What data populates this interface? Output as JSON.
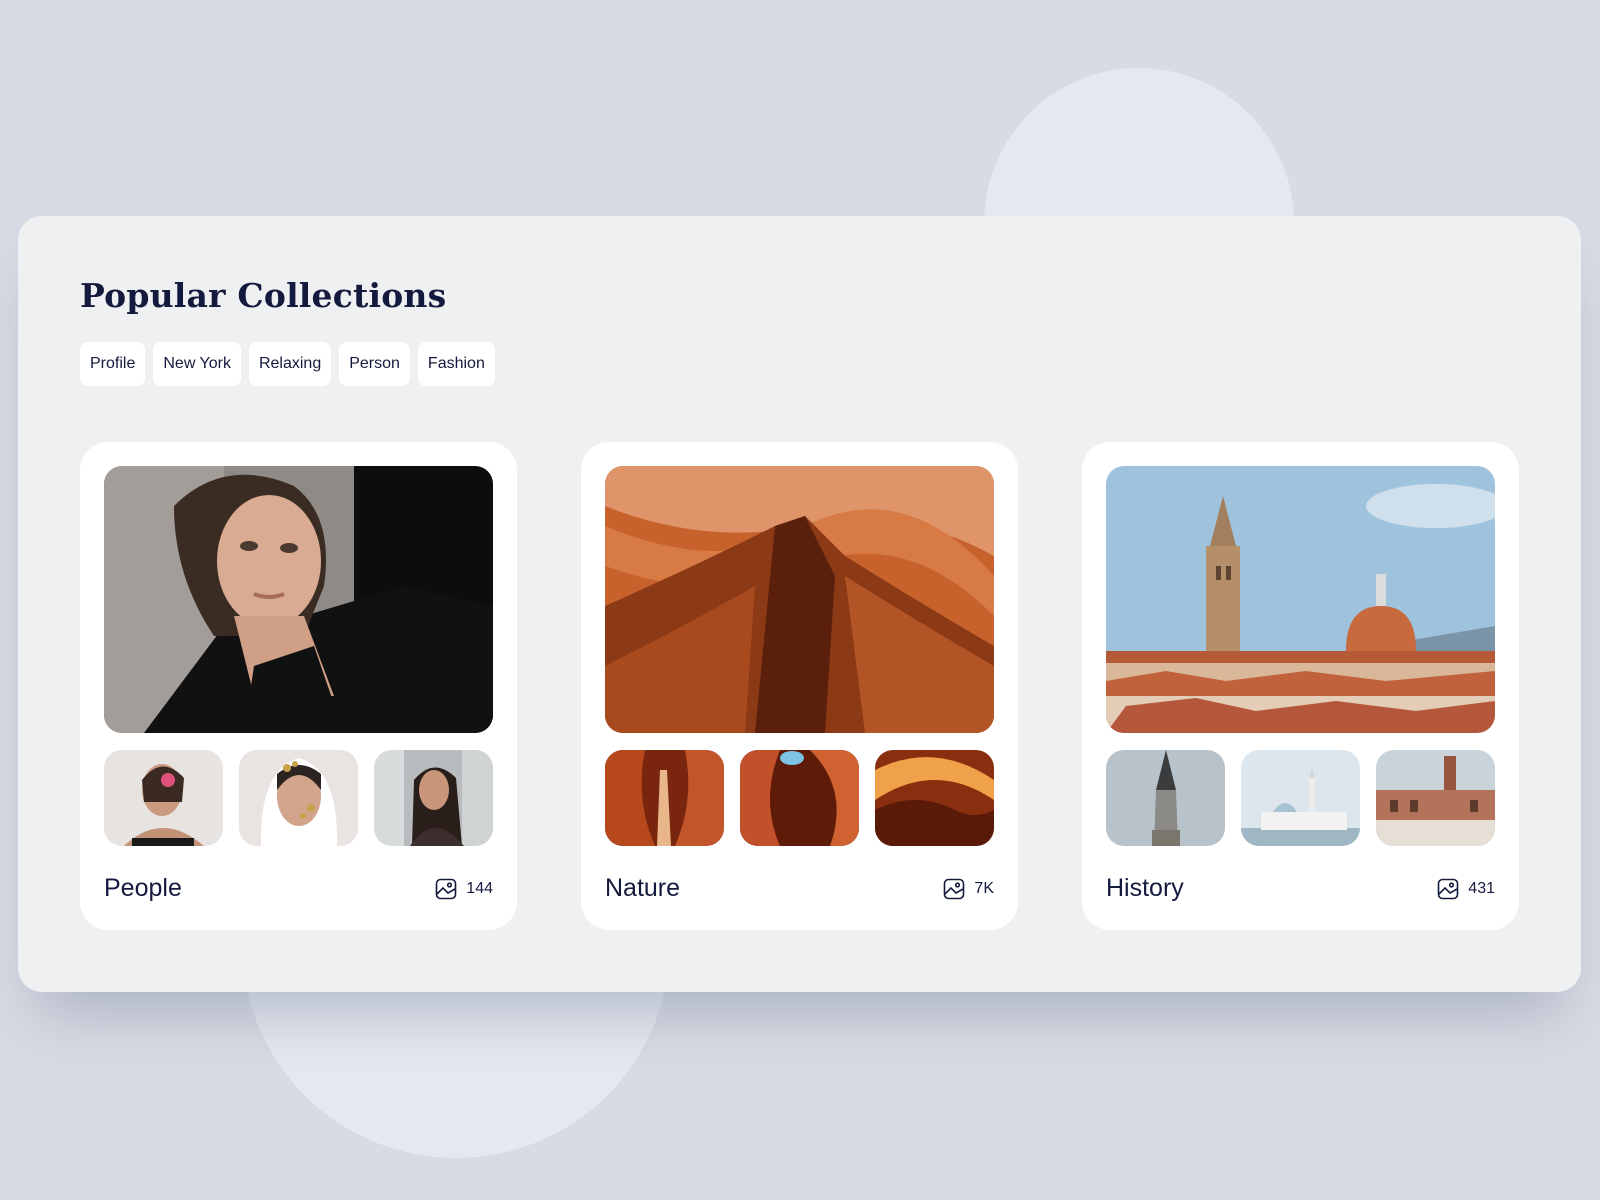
{
  "page": {
    "title": "Popular Collections"
  },
  "tags": [
    "Profile",
    "New York",
    "Relaxing",
    "Person",
    "Fashion"
  ],
  "collections": [
    {
      "name": "People",
      "count": "144",
      "count_icon": "image-icon",
      "hero": "portrait-photo",
      "thumbs": [
        "woman-with-flower-photo",
        "woman-with-gold-leaf-photo",
        "woman-at-window-photo"
      ]
    },
    {
      "name": "Nature",
      "count": "7K",
      "count_icon": "image-icon",
      "hero": "sandstone-canyon-photo",
      "thumbs": [
        "canyon-slot-photo",
        "canyon-arch-photo",
        "canyon-waves-photo"
      ]
    },
    {
      "name": "History",
      "count": "431",
      "count_icon": "image-icon",
      "hero": "city-rooftops-photo",
      "thumbs": [
        "minaret-photo",
        "mosque-photo",
        "palace-tower-photo"
      ]
    }
  ],
  "colors": {
    "background": "#d7dbe4",
    "panel": "#eff0f2",
    "card": "#ffffff",
    "text": "#141a3d"
  }
}
